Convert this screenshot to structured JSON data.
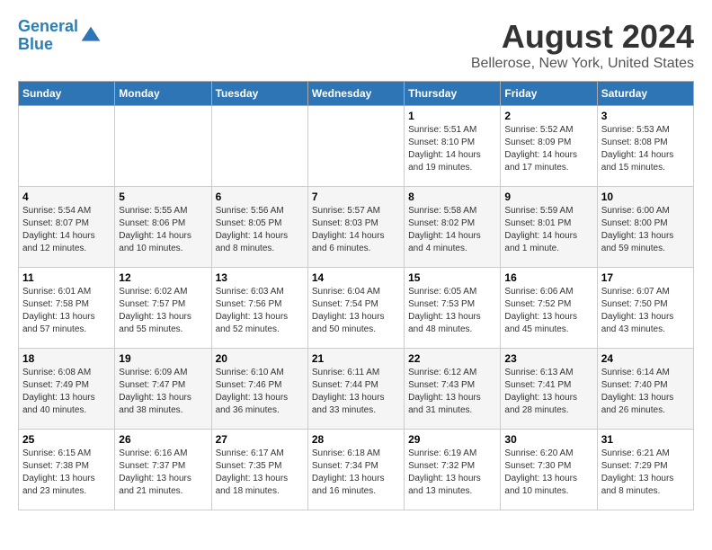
{
  "header": {
    "logo_line1": "General",
    "logo_line2": "Blue",
    "title": "August 2024",
    "subtitle": "Bellerose, New York, United States"
  },
  "weekdays": [
    "Sunday",
    "Monday",
    "Tuesday",
    "Wednesday",
    "Thursday",
    "Friday",
    "Saturday"
  ],
  "weeks": [
    [
      {
        "day": "",
        "info": ""
      },
      {
        "day": "",
        "info": ""
      },
      {
        "day": "",
        "info": ""
      },
      {
        "day": "",
        "info": ""
      },
      {
        "day": "1",
        "info": "Sunrise: 5:51 AM\nSunset: 8:10 PM\nDaylight: 14 hours\nand 19 minutes."
      },
      {
        "day": "2",
        "info": "Sunrise: 5:52 AM\nSunset: 8:09 PM\nDaylight: 14 hours\nand 17 minutes."
      },
      {
        "day": "3",
        "info": "Sunrise: 5:53 AM\nSunset: 8:08 PM\nDaylight: 14 hours\nand 15 minutes."
      }
    ],
    [
      {
        "day": "4",
        "info": "Sunrise: 5:54 AM\nSunset: 8:07 PM\nDaylight: 14 hours\nand 12 minutes."
      },
      {
        "day": "5",
        "info": "Sunrise: 5:55 AM\nSunset: 8:06 PM\nDaylight: 14 hours\nand 10 minutes."
      },
      {
        "day": "6",
        "info": "Sunrise: 5:56 AM\nSunset: 8:05 PM\nDaylight: 14 hours\nand 8 minutes."
      },
      {
        "day": "7",
        "info": "Sunrise: 5:57 AM\nSunset: 8:03 PM\nDaylight: 14 hours\nand 6 minutes."
      },
      {
        "day": "8",
        "info": "Sunrise: 5:58 AM\nSunset: 8:02 PM\nDaylight: 14 hours\nand 4 minutes."
      },
      {
        "day": "9",
        "info": "Sunrise: 5:59 AM\nSunset: 8:01 PM\nDaylight: 14 hours\nand 1 minute."
      },
      {
        "day": "10",
        "info": "Sunrise: 6:00 AM\nSunset: 8:00 PM\nDaylight: 13 hours\nand 59 minutes."
      }
    ],
    [
      {
        "day": "11",
        "info": "Sunrise: 6:01 AM\nSunset: 7:58 PM\nDaylight: 13 hours\nand 57 minutes."
      },
      {
        "day": "12",
        "info": "Sunrise: 6:02 AM\nSunset: 7:57 PM\nDaylight: 13 hours\nand 55 minutes."
      },
      {
        "day": "13",
        "info": "Sunrise: 6:03 AM\nSunset: 7:56 PM\nDaylight: 13 hours\nand 52 minutes."
      },
      {
        "day": "14",
        "info": "Sunrise: 6:04 AM\nSunset: 7:54 PM\nDaylight: 13 hours\nand 50 minutes."
      },
      {
        "day": "15",
        "info": "Sunrise: 6:05 AM\nSunset: 7:53 PM\nDaylight: 13 hours\nand 48 minutes."
      },
      {
        "day": "16",
        "info": "Sunrise: 6:06 AM\nSunset: 7:52 PM\nDaylight: 13 hours\nand 45 minutes."
      },
      {
        "day": "17",
        "info": "Sunrise: 6:07 AM\nSunset: 7:50 PM\nDaylight: 13 hours\nand 43 minutes."
      }
    ],
    [
      {
        "day": "18",
        "info": "Sunrise: 6:08 AM\nSunset: 7:49 PM\nDaylight: 13 hours\nand 40 minutes."
      },
      {
        "day": "19",
        "info": "Sunrise: 6:09 AM\nSunset: 7:47 PM\nDaylight: 13 hours\nand 38 minutes."
      },
      {
        "day": "20",
        "info": "Sunrise: 6:10 AM\nSunset: 7:46 PM\nDaylight: 13 hours\nand 36 minutes."
      },
      {
        "day": "21",
        "info": "Sunrise: 6:11 AM\nSunset: 7:44 PM\nDaylight: 13 hours\nand 33 minutes."
      },
      {
        "day": "22",
        "info": "Sunrise: 6:12 AM\nSunset: 7:43 PM\nDaylight: 13 hours\nand 31 minutes."
      },
      {
        "day": "23",
        "info": "Sunrise: 6:13 AM\nSunset: 7:41 PM\nDaylight: 13 hours\nand 28 minutes."
      },
      {
        "day": "24",
        "info": "Sunrise: 6:14 AM\nSunset: 7:40 PM\nDaylight: 13 hours\nand 26 minutes."
      }
    ],
    [
      {
        "day": "25",
        "info": "Sunrise: 6:15 AM\nSunset: 7:38 PM\nDaylight: 13 hours\nand 23 minutes."
      },
      {
        "day": "26",
        "info": "Sunrise: 6:16 AM\nSunset: 7:37 PM\nDaylight: 13 hours\nand 21 minutes."
      },
      {
        "day": "27",
        "info": "Sunrise: 6:17 AM\nSunset: 7:35 PM\nDaylight: 13 hours\nand 18 minutes."
      },
      {
        "day": "28",
        "info": "Sunrise: 6:18 AM\nSunset: 7:34 PM\nDaylight: 13 hours\nand 16 minutes."
      },
      {
        "day": "29",
        "info": "Sunrise: 6:19 AM\nSunset: 7:32 PM\nDaylight: 13 hours\nand 13 minutes."
      },
      {
        "day": "30",
        "info": "Sunrise: 6:20 AM\nSunset: 7:30 PM\nDaylight: 13 hours\nand 10 minutes."
      },
      {
        "day": "31",
        "info": "Sunrise: 6:21 AM\nSunset: 7:29 PM\nDaylight: 13 hours\nand 8 minutes."
      }
    ]
  ]
}
